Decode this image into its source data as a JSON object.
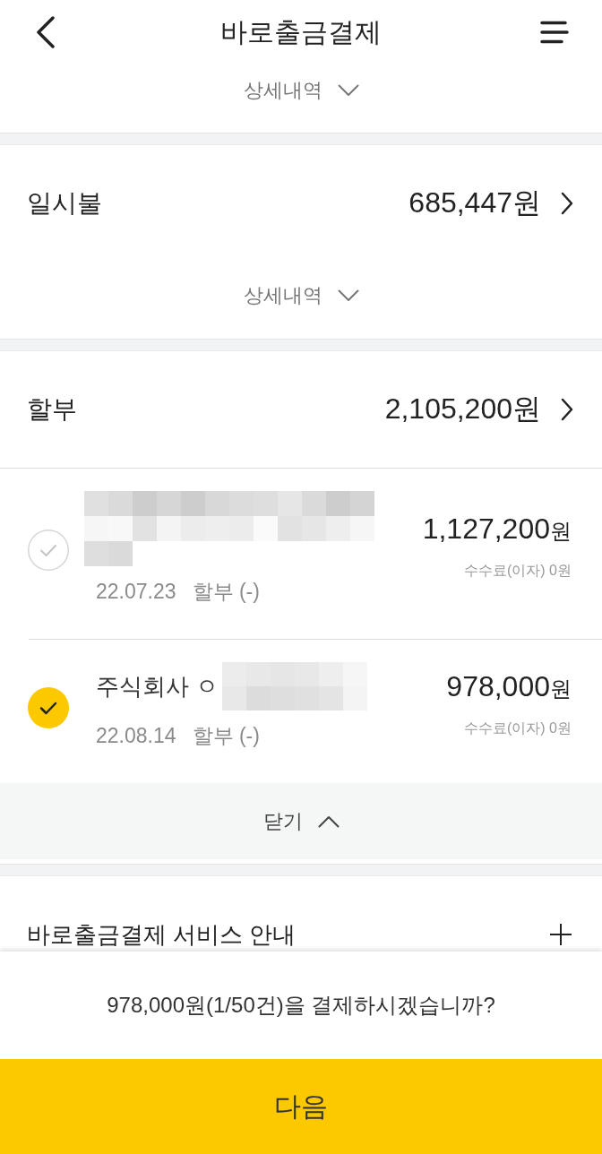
{
  "header": {
    "title": "바로출금결제"
  },
  "sections": [
    {
      "kind": "toggle",
      "toggle": {
        "label": "상세내역",
        "expanded": false
      }
    },
    {
      "kind": "category",
      "label": "일시불",
      "amount": "685,447원",
      "toggle": {
        "label": "상세내역",
        "expanded": false
      }
    },
    {
      "kind": "category",
      "label": "할부",
      "amount": "2,105,200원",
      "toggle": {
        "label": "닫기",
        "expanded": true
      },
      "items": [
        {
          "redacted": true,
          "checked": false,
          "amount": "1,127,200",
          "unit": "원",
          "fee": "수수료(이자) 0원",
          "date": "22.07.23",
          "type": "할부 (-)"
        },
        {
          "name": "주식회사 ㅇ",
          "redacted": true,
          "checked": true,
          "amount": "978,000",
          "unit": "원",
          "fee": "수수료(이자) 0원",
          "date": "22.08.14",
          "type": "할부 (-)"
        }
      ]
    },
    {
      "kind": "info",
      "label": "바로출금결제 서비스 안내"
    }
  ],
  "confirm": {
    "message": "978,000원(1/50건)을 결제하시겠습니까?",
    "button": "다음"
  }
}
